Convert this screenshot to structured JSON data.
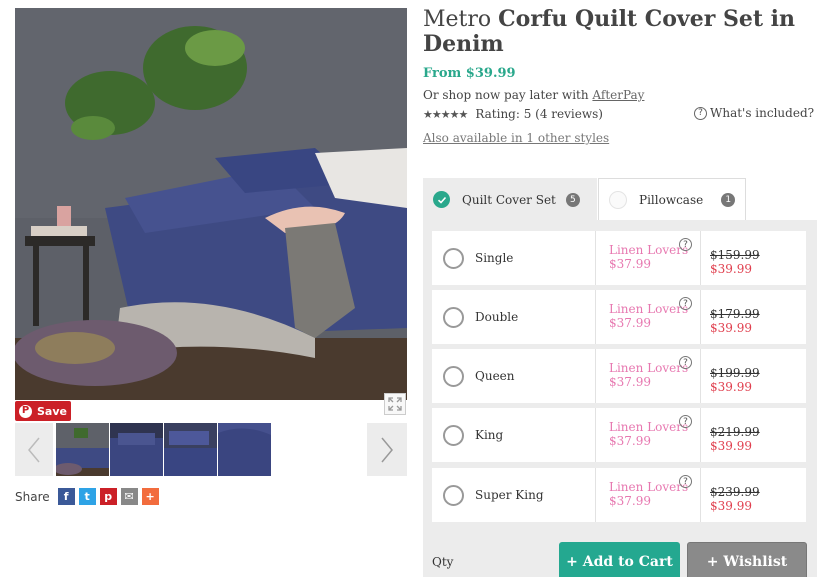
{
  "product": {
    "brand": "Metro",
    "name": "Corfu Quilt Cover Set in Denim",
    "price_from": "From $39.99",
    "afterpay_text": "Or shop now pay later with",
    "afterpay_link": "AfterPay",
    "stars_text": "★★★★★",
    "rating_text": "Rating: 5 (4 reviews)",
    "whats_included": "What's included?",
    "also_available": "Also available in 1 other styles"
  },
  "gallery": {
    "pin_label": "Save",
    "share_label": "Share",
    "share_icons": [
      {
        "name": "facebook-icon",
        "glyph": "f",
        "color": "#3b5998"
      },
      {
        "name": "twitter-icon",
        "glyph": "t",
        "color": "#2ea3e6"
      },
      {
        "name": "pinterest-icon",
        "glyph": "p",
        "color": "#cb2027"
      },
      {
        "name": "email-icon",
        "glyph": "✉",
        "color": "#888888"
      },
      {
        "name": "plus-icon",
        "glyph": "+",
        "color": "#f26c3d"
      }
    ]
  },
  "tabs": [
    {
      "label": "Quilt Cover Set",
      "count": "5"
    },
    {
      "label": "Pillowcase",
      "count": "1"
    }
  ],
  "sizes": [
    {
      "label": "Single",
      "promo": "Linen Lovers",
      "promo_price": "$37.99",
      "was": "$159.99",
      "now": "$39.99"
    },
    {
      "label": "Double",
      "promo": "Linen Lovers",
      "promo_price": "$37.99",
      "was": "$179.99",
      "now": "$39.99"
    },
    {
      "label": "Queen",
      "promo": "Linen Lovers",
      "promo_price": "$37.99",
      "was": "$199.99",
      "now": "$39.99"
    },
    {
      "label": "King",
      "promo": "Linen Lovers",
      "promo_price": "$37.99",
      "was": "$219.99",
      "now": "$39.99"
    },
    {
      "label": "Super King",
      "promo": "Linen Lovers",
      "promo_price": "$37.99",
      "was": "$239.99",
      "now": "$39.99"
    }
  ],
  "actions": {
    "qty_label": "Qty",
    "add_to_cart": "+ Add to Cart",
    "wishlist": "+ Wishlist"
  },
  "colors": {
    "accent": "#2aa88c",
    "promo": "#e778b0",
    "sale": "#e0404f"
  }
}
